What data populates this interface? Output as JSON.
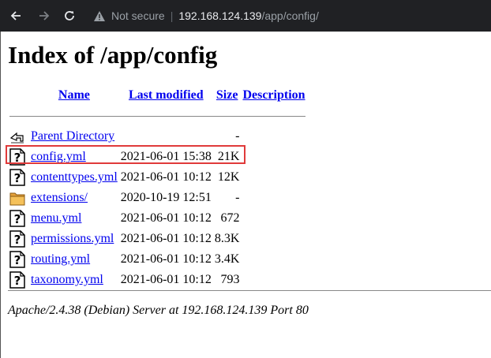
{
  "browser": {
    "security_label": "Not secure",
    "url_host": "192.168.124.139",
    "url_path": "/app/config/"
  },
  "page": {
    "title": "Index of /app/config",
    "columns": {
      "name": "Name",
      "last_modified": "Last modified",
      "size": "Size",
      "description": "Description"
    },
    "parent": {
      "label": "Parent Directory",
      "size": "-"
    },
    "rows": [
      {
        "name": "config.yml",
        "modified": "2021-06-01 15:38",
        "size": "21K",
        "type": "file"
      },
      {
        "name": "contenttypes.yml",
        "modified": "2021-06-01 10:12",
        "size": "12K",
        "type": "file"
      },
      {
        "name": "extensions/",
        "modified": "2020-10-19 12:51",
        "size": "-",
        "type": "folder"
      },
      {
        "name": "menu.yml",
        "modified": "2021-06-01 10:12",
        "size": "672",
        "type": "file"
      },
      {
        "name": "permissions.yml",
        "modified": "2021-06-01 10:12",
        "size": "8.3K",
        "type": "file"
      },
      {
        "name": "routing.yml",
        "modified": "2021-06-01 10:12",
        "size": "3.4K",
        "type": "file"
      },
      {
        "name": "taxonomy.yml",
        "modified": "2021-06-01 10:12",
        "size": "793",
        "type": "file"
      }
    ],
    "footer": "Apache/2.4.38 (Debian) Server at 192.168.124.139 Port 80"
  },
  "colors": {
    "highlight": "#e03a3a",
    "link": "#0000ee",
    "toolbar": "#202124"
  }
}
